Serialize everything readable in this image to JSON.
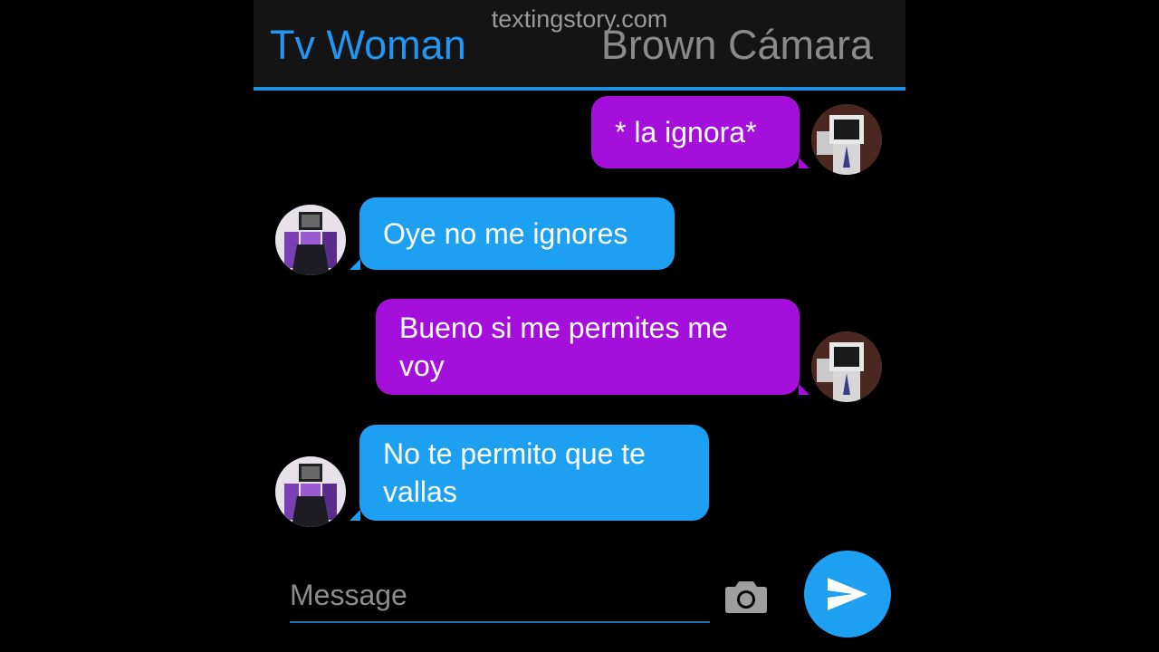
{
  "header": {
    "watermark": "textingstory.com",
    "left_contact": "Tv Woman",
    "right_contact": "Brown Cámara"
  },
  "messages": [
    {
      "sender": "Brown Cámara",
      "side": "right",
      "text": "* la ignora*"
    },
    {
      "sender": "Tv Woman",
      "side": "left",
      "text": "Oye no me ignores"
    },
    {
      "sender": "Brown Cámara",
      "side": "right",
      "text": "Bueno si me permites me voy"
    },
    {
      "sender": "Tv Woman",
      "side": "left",
      "text": "No te permito que te vallas"
    }
  ],
  "composer": {
    "placeholder": "Message"
  },
  "colors": {
    "purple_bubble": "#a40fdc",
    "blue_bubble": "#1ea0f2",
    "accent": "#1f8fe0"
  },
  "icons": {
    "camera": "camera-icon",
    "send": "send-icon"
  }
}
